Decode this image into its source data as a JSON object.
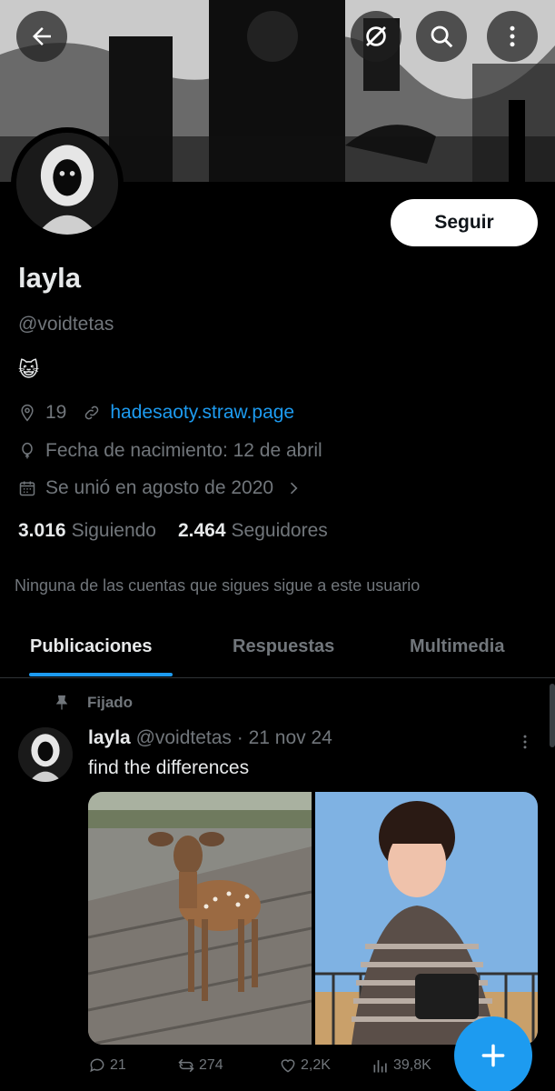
{
  "profile": {
    "name": "layla",
    "handle": "@voidtetas",
    "bio": "😺",
    "location": "19",
    "website": "hadesaoty.straw.page",
    "birthday": "Fecha de nacimiento: 12 de abril",
    "joined": "Se unió en agosto de 2020",
    "following_count": "3.016",
    "following_label": "Siguiendo",
    "followers_count": "2.464",
    "followers_label": "Seguidores",
    "mutuals_notice": "Ninguna de las cuentas que sigues sigue a este usuario"
  },
  "header": {
    "follow_label": "Seguir",
    "icons": [
      "back-arrow-icon",
      "grok-icon",
      "search-icon",
      "more-vertical-icon"
    ]
  },
  "tabs": [
    {
      "label": "Publicaciones",
      "active": true
    },
    {
      "label": "Respuestas",
      "active": false
    },
    {
      "label": "Multimedia",
      "active": false
    }
  ],
  "post": {
    "pinned_label": "Fijado",
    "author": "layla",
    "handle": "@voidtetas",
    "date": "· 21 nov 24",
    "text": "find the differences",
    "replies": "21",
    "reposts": "274",
    "likes": "2,2K",
    "views": "39,8K"
  },
  "colors": {
    "accent": "#1d9bf0",
    "background": "#000000",
    "text_primary": "#e7e9ea",
    "text_secondary": "#71767b"
  }
}
